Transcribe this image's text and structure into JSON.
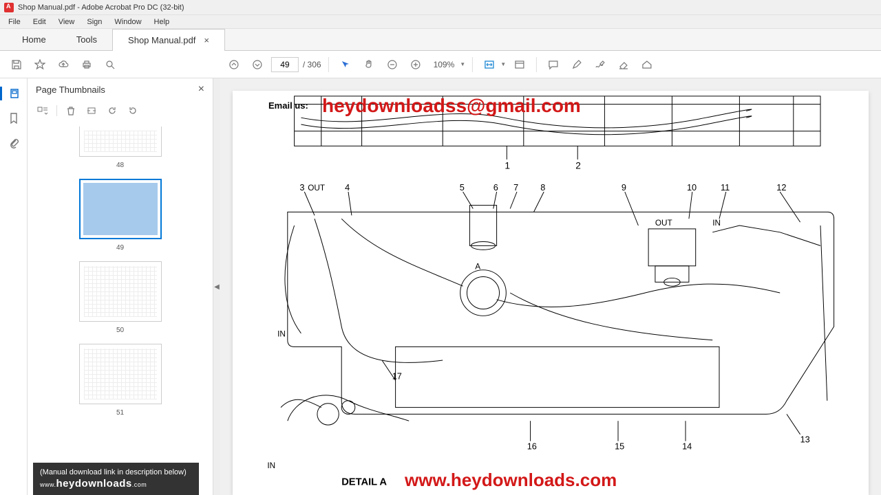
{
  "window": {
    "title": "Shop Manual.pdf - Adobe Acrobat Pro DC (32-bit)"
  },
  "menu": {
    "items": [
      "File",
      "Edit",
      "View",
      "Sign",
      "Window",
      "Help"
    ]
  },
  "tabs": {
    "home": "Home",
    "tools": "Tools",
    "doc": "Shop Manual.pdf"
  },
  "toolbar": {
    "page_current": "49",
    "page_total": "/ 306",
    "zoom": "109%"
  },
  "thumbnails": {
    "panel_title": "Page Thumbnails",
    "pages": [
      {
        "num": "48"
      },
      {
        "num": "49"
      },
      {
        "num": "50"
      },
      {
        "num": "51"
      }
    ]
  },
  "banner": {
    "line1": "(Manual download link in description below)",
    "prefix": "www.",
    "brand": "heydownloads",
    "suffix": ".com"
  },
  "doc": {
    "email_label": "Email us:",
    "email": "heydownloadss@gmail.com",
    "url": "www.heydownloads.com",
    "callouts_top": [
      "1",
      "2"
    ],
    "callouts_row": [
      "3",
      "4",
      "5",
      "6",
      "7",
      "8",
      "9",
      "10",
      "11",
      "12"
    ],
    "callouts_bottom": [
      "13",
      "14",
      "15",
      "16",
      "17"
    ],
    "labels": {
      "out": "OUT",
      "in": "IN",
      "detailA": "DETAIL A",
      "A": "A"
    }
  }
}
